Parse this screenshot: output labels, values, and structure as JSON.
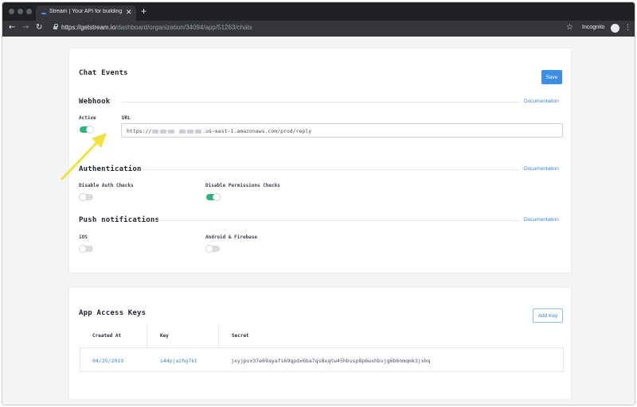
{
  "browser": {
    "tab_title": "Stream | Your API for building s",
    "url_host": "https://getstream.io",
    "url_path": "/dashboard/organization/34094/app/51263/chats",
    "incognito_label": "Incognito"
  },
  "chat_events": {
    "title": "Chat Events",
    "save_label": "Save",
    "webhook": {
      "title": "Webhook",
      "doc_label": "Documentation",
      "active_label": "Active",
      "active_on": true,
      "url_label": "URL",
      "url_prefix": "https://",
      "url_suffix": ".us-east-1.amazonaws.com/prod/reply"
    },
    "authentication": {
      "title": "Authentication",
      "doc_label": "Documentation",
      "disable_auth_label": "Disable Auth Checks",
      "disable_auth_on": false,
      "disable_perm_label": "Disable Permissions Checks",
      "disable_perm_on": true
    },
    "push": {
      "title": "Push notifications",
      "doc_label": "Documentation",
      "ios_label": "iOS",
      "ios_on": false,
      "android_label": "Android & Firebase",
      "android_on": false
    }
  },
  "access_keys": {
    "title": "App Access Keys",
    "add_key_label": "Add Key",
    "columns": [
      "Created At",
      "Key",
      "Secret"
    ],
    "rows": [
      {
        "created_at": "04/25/2019",
        "key": "s44pjazhg7kt",
        "secret": "jxyjpvx37e69ayafs69qpdx6ba7qs8xqtw45hbvsp8p6wxhbvjg6b6nmqmk3jxhq"
      }
    ]
  },
  "annotation": {
    "arrow_color": "#f3e23c"
  }
}
